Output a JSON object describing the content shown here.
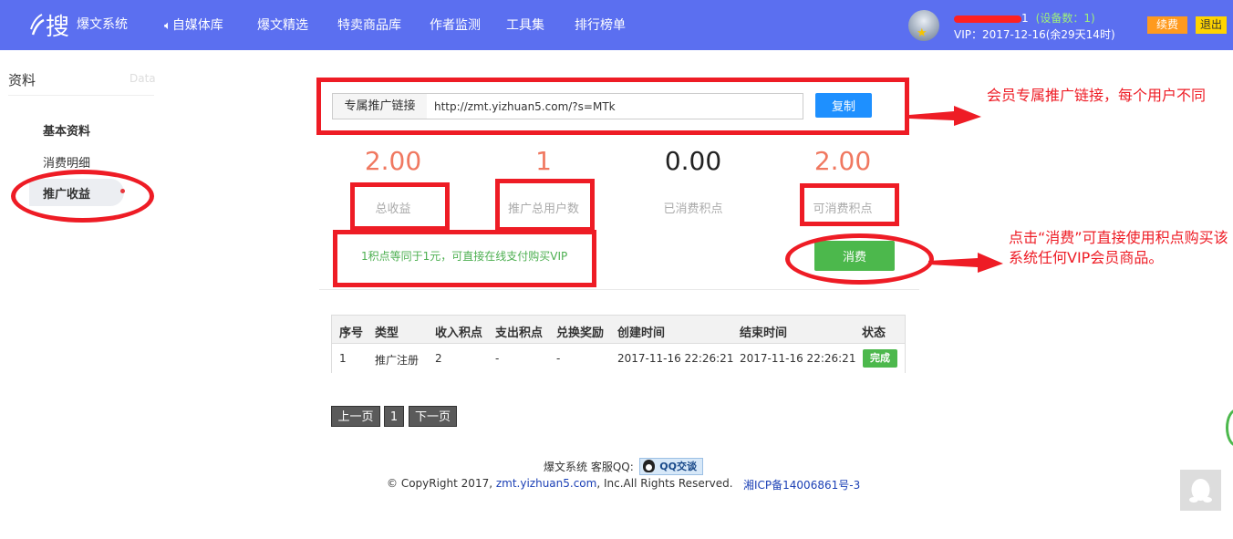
{
  "header": {
    "logo_text": "爆文系统",
    "nav": [
      {
        "label": "自媒体库",
        "icon": "speaker-icon"
      },
      {
        "label": "爆文精选"
      },
      {
        "label": "特卖商品库"
      },
      {
        "label": "作者监测"
      },
      {
        "label": "工具集"
      },
      {
        "label": "排行榜单"
      }
    ],
    "user_suffix": "1",
    "device_count": "(设备数：1)",
    "vip_info": "VIP：2017-12-16(余29天14时)",
    "renew_label": "续费",
    "logout_label": "退出"
  },
  "sidebar": {
    "title": "资料",
    "title_en": "Data",
    "items": [
      {
        "label": "基本资料",
        "bold": true
      },
      {
        "label": "消费明细"
      },
      {
        "label": "推广收益",
        "active": true,
        "bold": true
      }
    ]
  },
  "promo": {
    "link_label": "专属推广链接",
    "link_value": "http://zmt.yizhuan5.com/?s=MTk",
    "copy_label": "复制"
  },
  "stats": [
    {
      "value": "2.00",
      "label": "总收益",
      "color": "#f07860"
    },
    {
      "value": "1",
      "label": "推广总用户数",
      "color": "#f07860"
    },
    {
      "value": "0.00",
      "label": "已消费积点",
      "color": "#222222"
    },
    {
      "value": "2.00",
      "label": "可消费积点",
      "color": "#f07860"
    }
  ],
  "note": "1积点等同于1元，可直接在线支付购买VIP",
  "consume_label": "消费",
  "table": {
    "headers": [
      "序号",
      "类型",
      "收入积点",
      "支出积点",
      "兑换奖励",
      "创建时间",
      "结束时间",
      "状态"
    ],
    "rows": [
      [
        "1",
        "推广注册",
        "2",
        "-",
        "-",
        "2017-11-16 22:26:21",
        "2017-11-16 22:26:21",
        "完成"
      ]
    ]
  },
  "pager": {
    "prev": "上一页",
    "current": "1",
    "next": "下一页"
  },
  "footer": {
    "line1": "爆文系统 客服QQ:",
    "qq_label": "QQ交谈",
    "copyright_prefix": "© CopyRight 2017, ",
    "copyright_link": "zmt.yizhuan5.com",
    "copyright_suffix": ", Inc.All Rights Reserved.",
    "icp": "湘ICP备14006861号-3"
  },
  "annotations": {
    "link_note": "会员专属推广链接，每个用户不同",
    "consume_note": "点击“消费”可直接使用积点购买该系统任何VIP会员商品。"
  },
  "colors": {
    "header_bg": "#5b6ff0",
    "accent_red": "#ee1c25",
    "copy_blue": "#1e90ff",
    "consume_green": "#4cb84c"
  }
}
